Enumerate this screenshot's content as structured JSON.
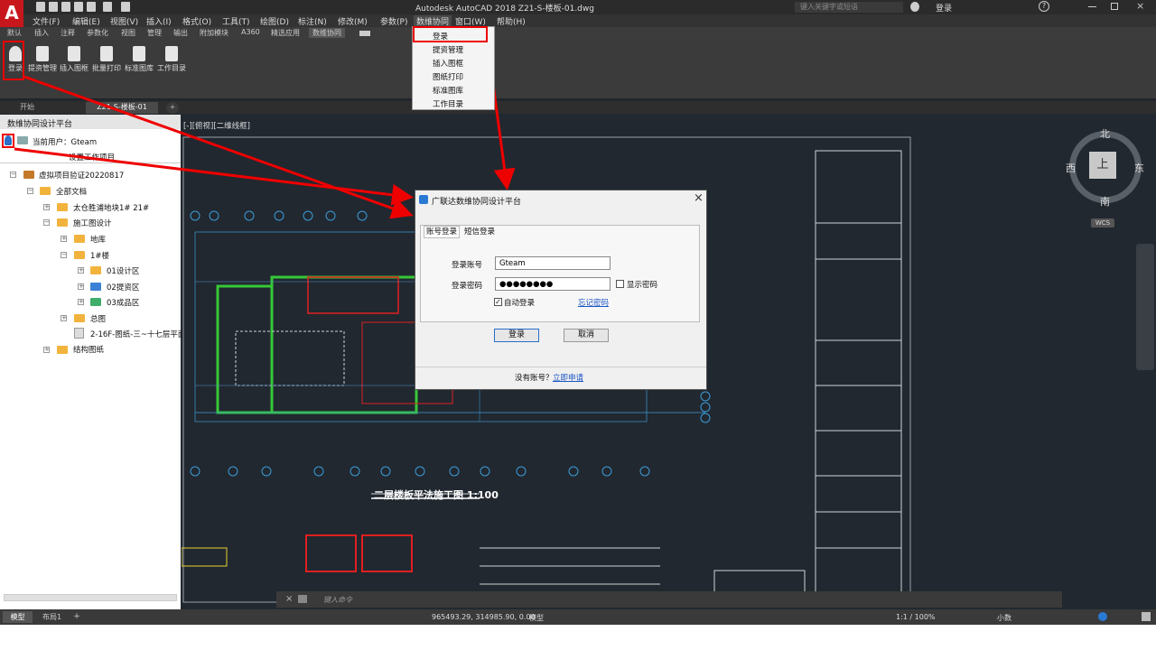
{
  "app": {
    "logo": "A",
    "title": "Autodesk AutoCAD 2018    Z21-S-楼板-01.dwg",
    "search_placeholder": "键入关键字或短语",
    "user": "登录",
    "help": "?"
  },
  "menu": [
    "文件(F)",
    "编辑(E)",
    "视图(V)",
    "插入(I)",
    "格式(O)",
    "工具(T)",
    "绘图(D)",
    "标注(N)",
    "修改(M)",
    "参数(P)",
    "数维协同",
    "窗口(W)",
    "帮助(H)"
  ],
  "ribbon_tabs": [
    "默认",
    "插入",
    "注释",
    "参数化",
    "视图",
    "管理",
    "输出",
    "附加模块",
    "A360",
    "精选应用",
    "数维协同"
  ],
  "ribbon_buttons": [
    "登录",
    "提资管理",
    "插入图框",
    "批量打印",
    "标准图库",
    "工作目录"
  ],
  "dropdown": [
    "登录",
    "提资管理",
    "插入图框",
    "图纸打印",
    "标准图库",
    "工作目录"
  ],
  "doc_tabs": [
    "开始",
    "Z21-S-楼板-01"
  ],
  "panel": {
    "title": "数维协同设计平台",
    "current_user": "当前用户：Gteam",
    "set_project": "设置工作项目",
    "tree": [
      {
        "label": "虚拟项目验证20220817",
        "level": 0
      },
      {
        "label": "全部文档",
        "level": 1
      },
      {
        "label": "太仓胜浦地块1#  21#",
        "level": 2
      },
      {
        "label": "施工图设计",
        "level": 2
      },
      {
        "label": "地库",
        "level": 3
      },
      {
        "label": "1#楼",
        "level": 3
      },
      {
        "label": "01设计区",
        "level": 4
      },
      {
        "label": "02提资区",
        "level": 4
      },
      {
        "label": "03成品区",
        "level": 4
      },
      {
        "label": "总图",
        "level": 3
      },
      {
        "label": "2-16F-图纸-三~十七层平面",
        "level": 3
      },
      {
        "label": "结构图纸",
        "level": 2
      }
    ]
  },
  "viewport_label": "[-][俯视][二维线框]",
  "viewcube": {
    "n": "北",
    "s": "南",
    "e": "东",
    "w": "西",
    "top": "上",
    "wcs": "WCS"
  },
  "drawing_title": "二层楼板平法施工图 1:100",
  "dialog": {
    "title": "广联达数维协同设计平台",
    "close": "×",
    "tab_account": "账号登录",
    "tab_sms": "短信登录",
    "account_label": "登录账号",
    "account_value": "Gteam",
    "password_label": "登录密码",
    "password_value": "●●●●●●●●",
    "show_password": "显示密码",
    "auto_login": "自动登录",
    "forgot": "忘记密码",
    "login_button": "登录",
    "cancel_button": "取消",
    "no_account": "没有账号？",
    "apply": "立即申请"
  },
  "cmd_placeholder": "键入命令",
  "status": {
    "coords": "965493.29, 314985.90, 0.00",
    "model": "模型",
    "scale": "1:1 / 100%",
    "units": "小数"
  },
  "layout_tabs": [
    "模型",
    "布局1",
    "+"
  ],
  "colors": {
    "accent_red": "#e00000",
    "brand_red": "#c8161d",
    "folder": "#f2b33d"
  }
}
